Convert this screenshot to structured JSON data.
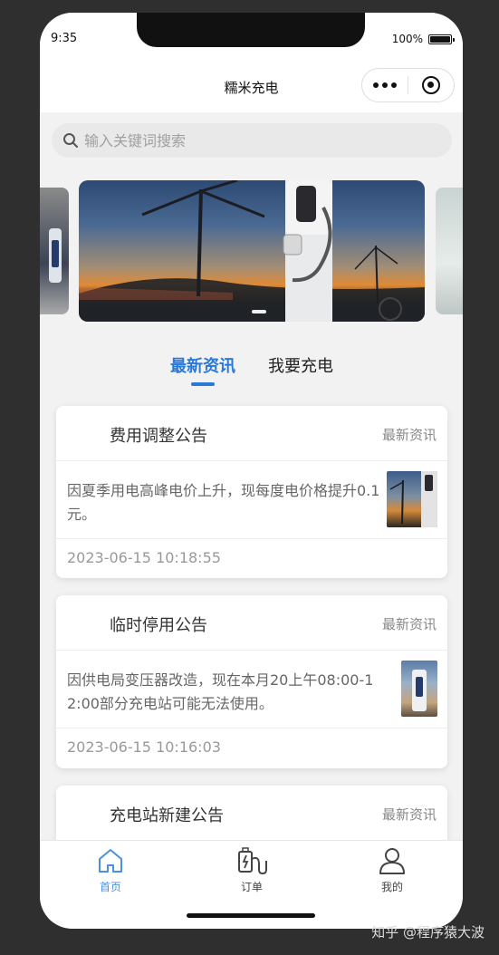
{
  "status": {
    "time": "9:35",
    "battery": "100%"
  },
  "navbar": {
    "title": "糯米充电"
  },
  "search": {
    "placeholder": "输入关键词搜索"
  },
  "tabs": [
    {
      "label": "最新资讯",
      "active": true
    },
    {
      "label": "我要充电",
      "active": false
    }
  ],
  "cards": [
    {
      "title": "费用调整公告",
      "tag": "最新资讯",
      "text": "因夏季用电高峰电价上升，现每度电价格提升0.1元。",
      "time": "2023-06-15 10:18:55"
    },
    {
      "title": "临时停用公告",
      "tag": "最新资讯",
      "text": "因供电局变压器改造，现在本月20上午08:00-12:00部分充电站可能无法使用。",
      "time": "2023-06-15 10:16:03"
    },
    {
      "title": "充电站新建公告",
      "tag": "最新资讯"
    }
  ],
  "tabbar": {
    "items": [
      {
        "label": "首页",
        "icon": "home-icon",
        "active": true
      },
      {
        "label": "订单",
        "icon": "order-icon",
        "active": false
      },
      {
        "label": "我的",
        "icon": "user-icon",
        "active": false
      }
    ]
  },
  "colors": {
    "accent": "#2b79d6",
    "tabbar_active": "#4a90e2"
  },
  "watermark": "知乎 @程序猿大波"
}
